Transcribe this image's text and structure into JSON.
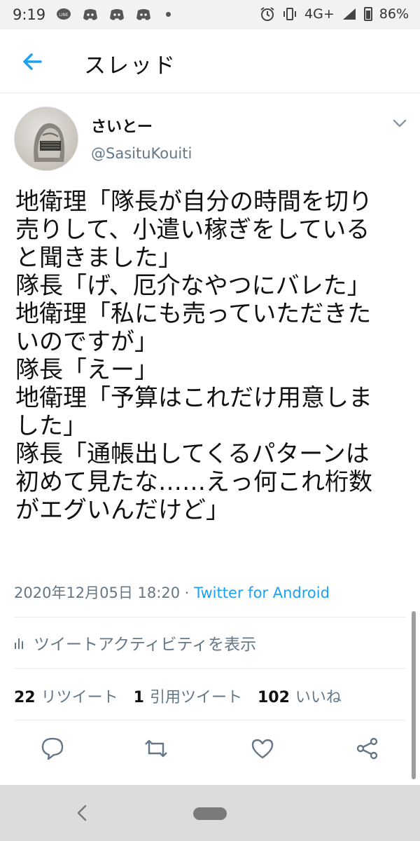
{
  "status_bar": {
    "time": "9:19",
    "line_label": "LINE",
    "network": "4G+",
    "battery": "86%"
  },
  "header": {
    "title": "スレッド"
  },
  "tweet": {
    "display_name": "さいとー",
    "handle": "@SasituKouiti",
    "lines": [
      "地衛理「隊長が自分の時間を切り",
      "売りして、小遣い稼ぎをしている",
      "と聞きました」",
      "隊長「げ、厄介なやつにバレた」",
      "地衛理「私にも売っていただきた",
      "いのですが」",
      "隊長「えー」",
      "地衛理「予算はこれだけ用意しま",
      "した」",
      "隊長「通帳出してくるパターンは",
      "初めて見たな……えっ何これ桁数",
      "がエグいんだけど」"
    ],
    "timestamp": "2020年12月05日 18:20",
    "separator": " · ",
    "source": "Twitter for Android",
    "activity_label": "ツイートアクティビティを表示",
    "retweets_count": "22",
    "retweets_label": "リツイート",
    "quotes_count": "1",
    "quotes_label": "引用ツイート",
    "likes_count": "102",
    "likes_label": "いいね"
  },
  "colors": {
    "accent": "#1da1f2",
    "secondary_text": "#657786",
    "divider": "#e6ecf0"
  },
  "icons": [
    "back-arrow-icon",
    "caret-down-icon",
    "bar-chart-icon",
    "reply-icon",
    "retweet-icon",
    "like-icon",
    "share-icon"
  ]
}
